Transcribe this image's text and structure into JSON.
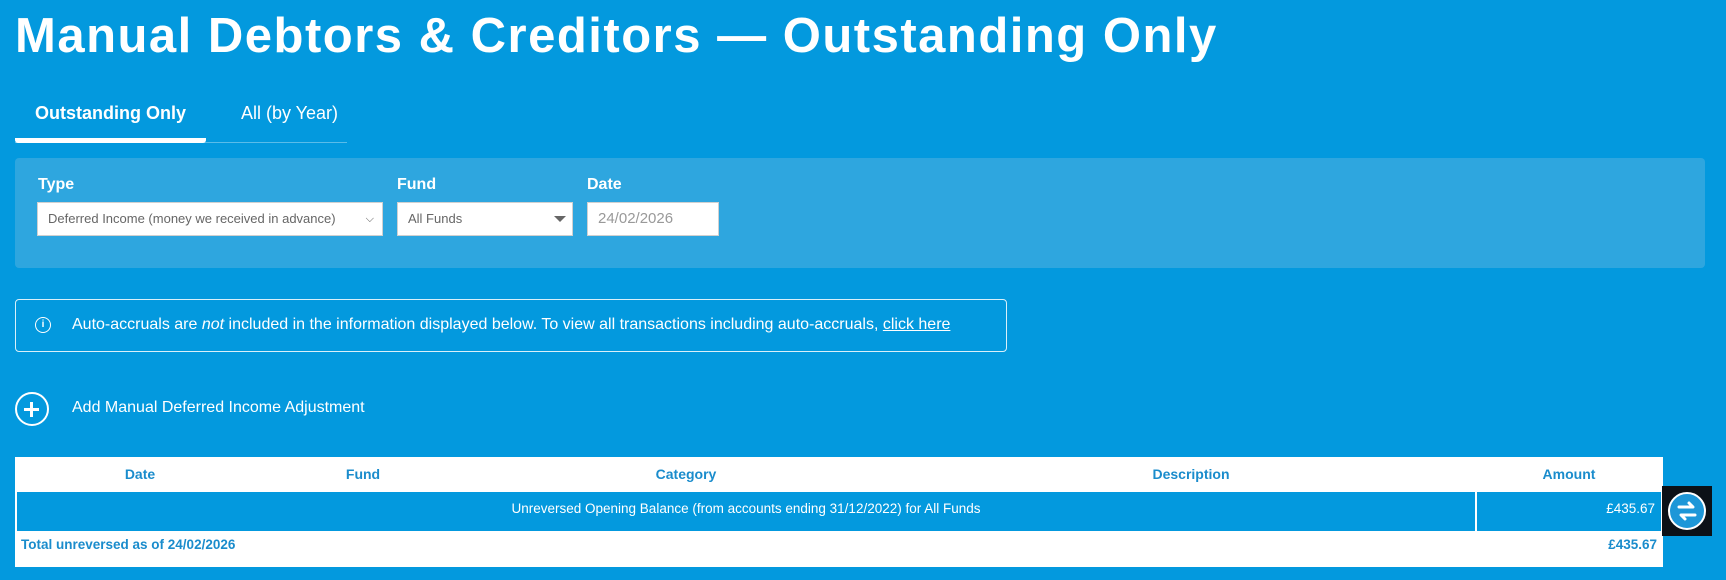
{
  "page": {
    "title": "Manual Debtors & Creditors — Outstanding Only"
  },
  "tabs": [
    {
      "label": "Outstanding Only",
      "active": true
    },
    {
      "label": "All (by Year)",
      "active": false
    }
  ],
  "filters": {
    "type": {
      "label": "Type",
      "value": "Deferred Income (money we received in advance)"
    },
    "fund": {
      "label": "Fund",
      "value": "All Funds"
    },
    "date": {
      "label": "Date",
      "value": "24/02/2026"
    }
  },
  "info": {
    "text_before": "Auto-accruals are ",
    "text_emphasis": "not",
    "text_after": " included in the information displayed below. To view all transactions including auto-accruals, ",
    "link": "click here"
  },
  "add_action": {
    "label": "Add Manual Deferred Income Adjustment",
    "icon": "plus-circle-icon"
  },
  "table": {
    "columns": [
      "Date",
      "Fund",
      "Category",
      "Description",
      "Amount"
    ],
    "rows": [
      {
        "description": "Unreversed Opening Balance (from accounts ending 31/12/2022) for All Funds",
        "amount": "£435.67"
      }
    ],
    "total": {
      "label": "Total unreversed as of 24/02/2026",
      "amount": "£435.67"
    }
  },
  "floating_button": {
    "icon": "swap-arrows-icon"
  },
  "colors": {
    "background": "#0399de",
    "panel": "#2ea6df",
    "table_header_text": "#1a8ccc",
    "white": "#ffffff"
  }
}
